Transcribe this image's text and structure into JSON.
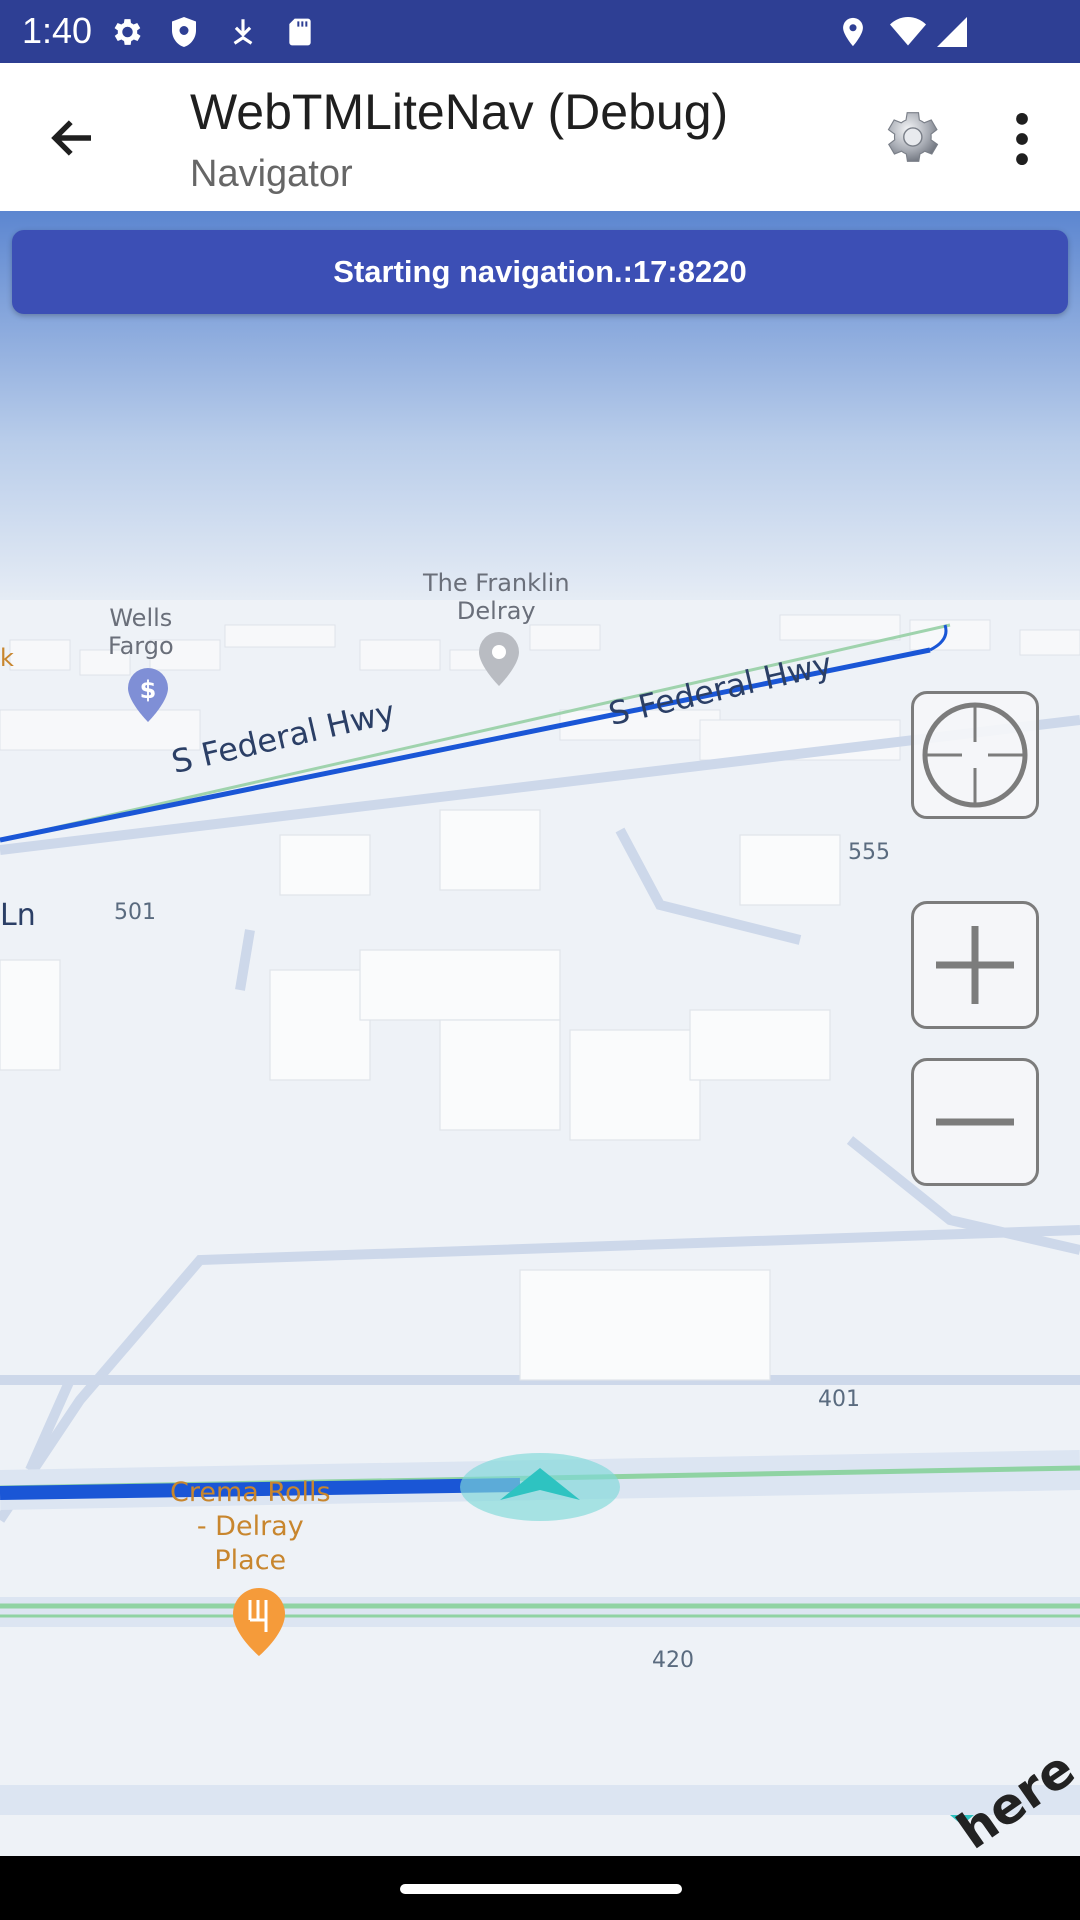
{
  "status_bar": {
    "time": "1:40",
    "icons": [
      "settings-icon",
      "shield-icon",
      "download-icon",
      "sd-card-icon",
      "location-icon",
      "wifi-icon",
      "signal-icon"
    ]
  },
  "app_bar": {
    "title": "WebTMLiteNav (Debug)",
    "subtitle": "Navigator"
  },
  "banner": {
    "text": "Starting navigation.:17:8220"
  },
  "map": {
    "labels": {
      "wells_fargo": "Wells\nFargo",
      "franklin": "The Franklin\nDelray",
      "hwy_1": "S Federal Hwy",
      "hwy_2": "S Federal Hwy",
      "num_501": "501",
      "num_555": "555",
      "num_401": "401",
      "num_420": "420",
      "ln": "Ln",
      "crema": "Crema Rolls\n- Delray\nPlace",
      "edge_k": "k",
      "brand": "here"
    },
    "colors": {
      "route": "#1a56d6",
      "restaurant": "#f59b3a",
      "bank": "#7f8fd6",
      "position": "#2ec3c1"
    }
  }
}
